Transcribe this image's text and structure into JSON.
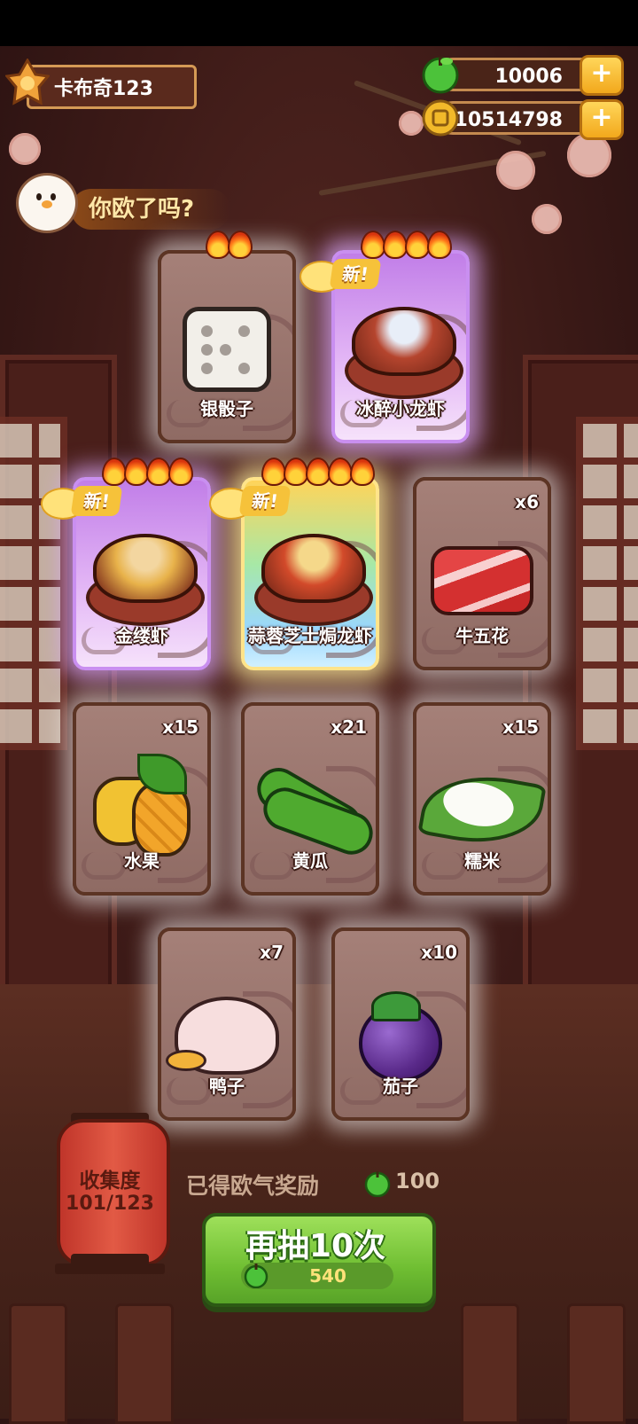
{
  "player": {
    "name": "卡布奇123"
  },
  "currency": {
    "green_coins": "10006",
    "gold_coins": "10514798",
    "plus_label": "+",
    "green_coin_icon": "green-apple-coin-icon",
    "gold_coin_icon": "gold-coin-icon"
  },
  "speech": {
    "text": "你欧了吗?"
  },
  "cards": [
    {
      "name": "银骰子",
      "count": "",
      "rarity": "common",
      "flames": 2,
      "is_new": false,
      "art": "dice-icon"
    },
    {
      "name": "冰醉小龙虾",
      "count": "",
      "rarity": "epic",
      "flames": 4,
      "is_new": true,
      "art": "crayfish-bowl-icon"
    },
    {
      "name": "金缕虾",
      "count": "",
      "rarity": "epic",
      "flames": 4,
      "is_new": true,
      "art": "golden-shrimp-icon"
    },
    {
      "name": "蒜蓉芝士焗龙虾",
      "count": "",
      "rarity": "legendary",
      "flames": 5,
      "is_new": true,
      "art": "lobster-cheese-icon"
    },
    {
      "name": "牛五花",
      "count": "x6",
      "rarity": "common",
      "flames": 0,
      "is_new": false,
      "art": "beef-icon"
    },
    {
      "name": "水果",
      "count": "x15",
      "rarity": "common",
      "flames": 0,
      "is_new": false,
      "art": "fruit-icon"
    },
    {
      "name": "黄瓜",
      "count": "x21",
      "rarity": "common",
      "flames": 0,
      "is_new": false,
      "art": "cucumber-icon"
    },
    {
      "name": "糯米",
      "count": "x15",
      "rarity": "common",
      "flames": 0,
      "is_new": false,
      "art": "sticky-rice-icon"
    },
    {
      "name": "鸭子",
      "count": "x7",
      "rarity": "common",
      "flames": 0,
      "is_new": false,
      "art": "duck-icon"
    },
    {
      "name": "茄子",
      "count": "x10",
      "rarity": "common",
      "flames": 0,
      "is_new": false,
      "art": "eggplant-icon"
    }
  ],
  "new_badge": "新!",
  "collection": {
    "label": "收集度",
    "progress": "101/123"
  },
  "reward": {
    "label": "已得欧气奖励",
    "amount": "100"
  },
  "draw_button": {
    "label": "再抽10次",
    "cost": "540"
  },
  "colors": {
    "common": "#8f6b64",
    "epic": "#c17ee8",
    "legendary": "#ffd45a",
    "button": "#6fbe32"
  }
}
